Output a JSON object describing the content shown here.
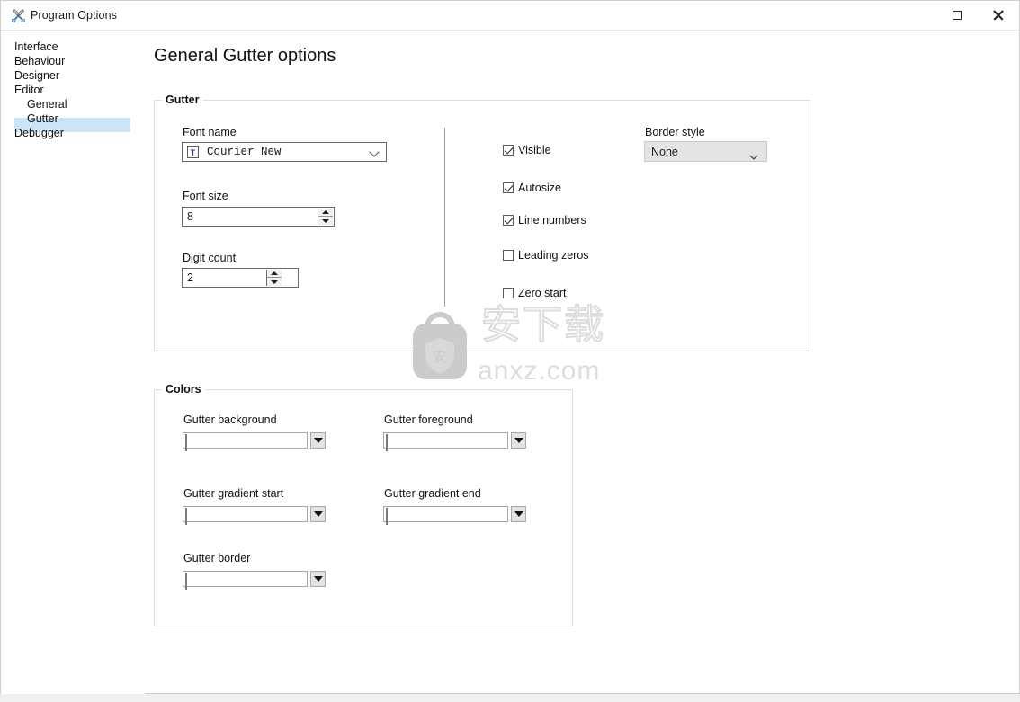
{
  "window": {
    "title": "Program Options",
    "icon": "tools-icon",
    "maximize_label": "Maximize",
    "close_label": "Close"
  },
  "sidebar": {
    "items": [
      {
        "label": "Interface",
        "level": 0,
        "selected": false
      },
      {
        "label": "Behaviour",
        "level": 0,
        "selected": false
      },
      {
        "label": "Designer",
        "level": 0,
        "selected": false
      },
      {
        "label": "Editor",
        "level": 0,
        "selected": false
      },
      {
        "label": "General",
        "level": 1,
        "selected": false
      },
      {
        "label": "Gutter",
        "level": 1,
        "selected": true
      },
      {
        "label": "Debugger",
        "level": 0,
        "selected": false
      }
    ]
  },
  "main": {
    "page_title": "General Gutter options",
    "gutter_group": {
      "legend": "Gutter",
      "font_name": {
        "label": "Font name",
        "value": "Courier New",
        "icon": "font-file-icon"
      },
      "font_size": {
        "label": "Font size",
        "value": "8"
      },
      "digit_count": {
        "label": "Digit count",
        "value": "2"
      },
      "checkboxes": [
        {
          "label": "Visible",
          "checked": true
        },
        {
          "label": "Autosize",
          "checked": true
        },
        {
          "label": "Line numbers",
          "checked": true
        },
        {
          "label": "Leading zeros",
          "checked": false
        },
        {
          "label": "Zero start",
          "checked": false
        }
      ],
      "border_style": {
        "label": "Border style",
        "value": "None"
      }
    },
    "colors_group": {
      "legend": "Colors",
      "items": [
        {
          "label": "Gutter background",
          "color": "#ffffff"
        },
        {
          "label": "Gutter foreground",
          "color": "#808080"
        },
        {
          "label": "Gutter gradient start",
          "color": "#ffffff"
        },
        {
          "label": "Gutter gradient end",
          "color": "#ffffff"
        },
        {
          "label": "Gutter border",
          "color": "#c0c0c0"
        }
      ]
    }
  },
  "watermark": {
    "cjk": "安下载",
    "domain": "anxz.com"
  },
  "theme": {
    "selection": "#cce4f7",
    "group_border": "#dedede",
    "text": "#111111"
  }
}
